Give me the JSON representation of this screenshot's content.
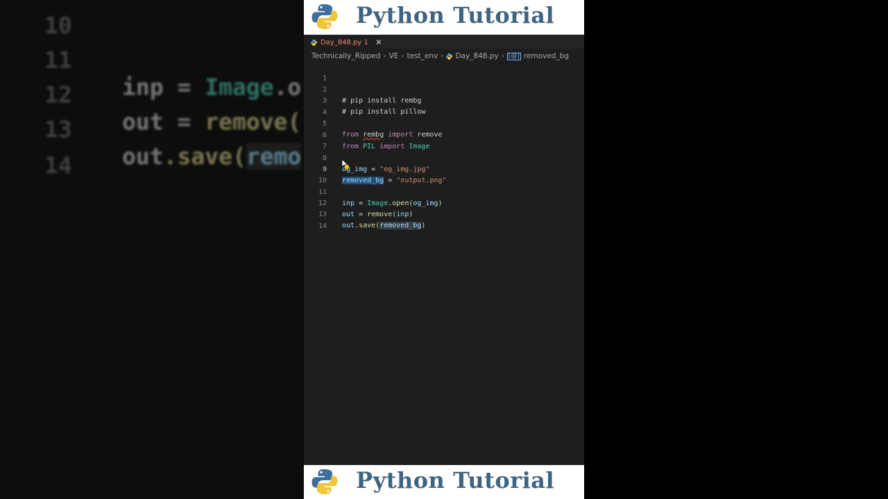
{
  "banner": {
    "title": "Python Tutorial"
  },
  "tab": {
    "label": "Day_848.py 1",
    "close": "✕"
  },
  "breadcrumb": [
    "Technically_Ripped",
    "VE",
    "test_env",
    "Day_848.py",
    "removed_bg"
  ],
  "code": {
    "l2": "# pip install rembg",
    "l3": "# pip install pillow",
    "l5_from": "from",
    "l5_mod": "rembg",
    "l5_import": "import",
    "l5_name": "remove",
    "l6_from": "from",
    "l6_mod": "PIL",
    "l6_import": "import",
    "l6_name": "Image",
    "l8_var": "og_img",
    "l8_eq": " = ",
    "l8_str": "\"og_img.jpg\"",
    "l9_var": "removed_bg",
    "l9_eq": " = ",
    "l9_str": "\"output.png\"",
    "l11_var": "inp",
    "l11_eq": " = ",
    "l11_cls": "Image",
    "l11_fn": ".open(",
    "l11_arg": "og_img",
    "l11_close": ")",
    "l12_var": "out",
    "l12_eq": " = ",
    "l12_fn": "remove(",
    "l12_arg": "inp",
    "l12_close": ")",
    "l13_var": "out",
    "l13_fn": ".save(",
    "l13_arg": "removed_bg",
    "l13_close": ")"
  },
  "line_numbers": [
    "1",
    "2",
    "3",
    "4",
    "5",
    "6",
    "7",
    "8",
    "9",
    "10",
    "11",
    "12",
    "13",
    "14"
  ],
  "background_zoom": {
    "lines": [
      {
        "ln": "10",
        "code": ""
      },
      {
        "ln": "11",
        "var": "inp",
        "eq": " = ",
        "cls": "Image",
        "rest": ".o"
      },
      {
        "ln": "12",
        "var": "out",
        "eq": " = ",
        "fn": "remove("
      },
      {
        "ln": "13",
        "var": "out",
        "fn": ".save(",
        "sel": "remo"
      },
      {
        "ln": "14",
        "code": ""
      }
    ]
  },
  "colors": {
    "accent": "#3f6480",
    "editor_bg": "#1e1e1e",
    "selection": "#264f78"
  }
}
